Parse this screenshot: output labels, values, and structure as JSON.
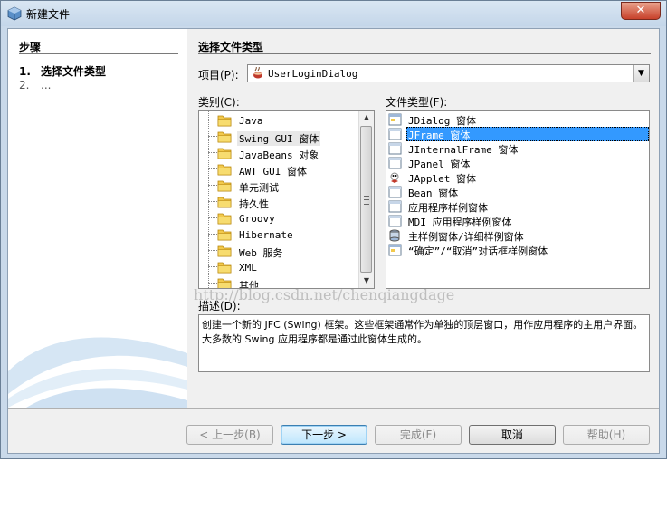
{
  "window": {
    "title": "新建文件",
    "close_label": "✕"
  },
  "steps": {
    "title": "步骤",
    "items": [
      {
        "num": "1.",
        "label": "选择文件类型"
      },
      {
        "num": "2.",
        "label": "..."
      }
    ]
  },
  "main": {
    "title": "选择文件类型",
    "project_label": "项目(P):",
    "project_value": "UserLoginDialog",
    "categories_label": "类别(C):",
    "file_types_label": "文件类型(F):",
    "categories": [
      "Java",
      "Swing GUI 窗体",
      "JavaBeans 对象",
      "AWT GUI 窗体",
      "单元测试",
      "持久性",
      "Groovy",
      "Hibernate",
      "Web 服务",
      "XML",
      "其他"
    ],
    "selected_category": "Swing GUI 窗体",
    "file_types": [
      "JDialog 窗体",
      "JFrame 窗体",
      "JInternalFrame 窗体",
      "JPanel 窗体",
      "JApplet 窗体",
      "Bean 窗体",
      "应用程序样例窗体",
      "MDI 应用程序样例窗体",
      "主样例窗体/详细样例窗体",
      "“确定”/“取消”对话框样例窗体"
    ],
    "selected_file_type": "JFrame 窗体",
    "description_label": "描述(D):",
    "description": "创建一个新的 JFC (Swing) 框架。这些框架通常作为单独的顶层窗口，用作应用程序的主用户界面。大多数的 Swing 应用程序都是通过此窗体生成的。"
  },
  "watermark": "http://blog.csdn.net/chenqiangdage",
  "buttons": {
    "back": "< 上一步(B)",
    "next": "下一步 >",
    "finish": "完成(F)",
    "cancel": "取消",
    "help": "帮助(H)"
  },
  "colors": {
    "selection": "#3399ff",
    "window_frame": "#c9d9ea"
  }
}
